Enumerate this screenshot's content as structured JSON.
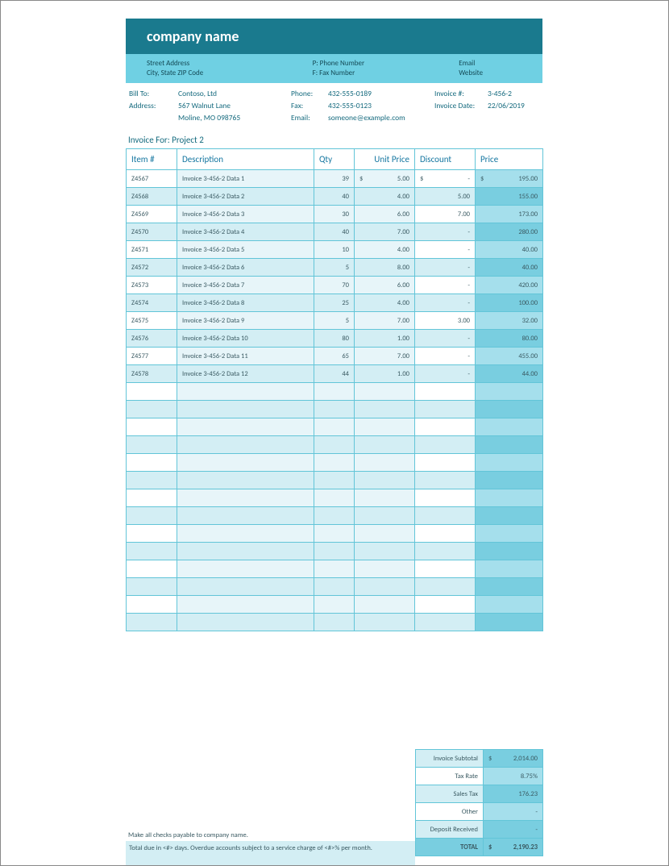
{
  "header": {
    "company": "company name"
  },
  "subheader": {
    "addr1": "Street Address",
    "addr2": "City, State ZIP Code",
    "phone": "P: Phone Number",
    "fax": "F: Fax Number",
    "email": "Email",
    "web": "Website"
  },
  "info": {
    "billto_lbl": "Bill To:",
    "billto": "Contoso, Ltd",
    "address_lbl": "Address:",
    "addr1": "567 Walnut Lane",
    "addr2": "Moline, MO 098765",
    "phone_lbl": "Phone:",
    "phone": "432-555-0189",
    "fax_lbl": "Fax:",
    "fax": "432-555-0123",
    "email_lbl": "Email:",
    "email": "someone@example.com",
    "invnum_lbl": "Invoice #:",
    "invnum": "3-456-2",
    "invdate_lbl": "Invoice Date:",
    "invdate": "22/06/2019"
  },
  "invoice_for_lbl": "Invoice For: ",
  "invoice_for": "Project 2",
  "columns": {
    "item": "Item #",
    "desc": "Description",
    "qty": "Qty",
    "unit": "Unit Price",
    "disc": "Discount",
    "price": "Price"
  },
  "rows": [
    {
      "item": "Z4567",
      "desc": "Invoice 3-456-2 Data 1",
      "qty": "39",
      "unit_cur": "$",
      "unit": "5.00",
      "disc_cur": "$",
      "disc": "-",
      "price_cur": "$",
      "price": "195.00"
    },
    {
      "item": "Z4568",
      "desc": "Invoice 3-456-2 Data 2",
      "qty": "40",
      "unit_cur": "",
      "unit": "4.00",
      "disc_cur": "",
      "disc": "5.00",
      "price_cur": "",
      "price": "155.00"
    },
    {
      "item": "Z4569",
      "desc": "Invoice 3-456-2 Data 3",
      "qty": "30",
      "unit_cur": "",
      "unit": "6.00",
      "disc_cur": "",
      "disc": "7.00",
      "price_cur": "",
      "price": "173.00"
    },
    {
      "item": "Z4570",
      "desc": "Invoice 3-456-2 Data 4",
      "qty": "40",
      "unit_cur": "",
      "unit": "7.00",
      "disc_cur": "",
      "disc": "-",
      "price_cur": "",
      "price": "280.00"
    },
    {
      "item": "Z4571",
      "desc": "Invoice 3-456-2 Data 5",
      "qty": "10",
      "unit_cur": "",
      "unit": "4.00",
      "disc_cur": "",
      "disc": "-",
      "price_cur": "",
      "price": "40.00"
    },
    {
      "item": "Z4572",
      "desc": "Invoice 3-456-2 Data 6",
      "qty": "5",
      "unit_cur": "",
      "unit": "8.00",
      "disc_cur": "",
      "disc": "-",
      "price_cur": "",
      "price": "40.00"
    },
    {
      "item": "Z4573",
      "desc": "Invoice 3-456-2 Data 7",
      "qty": "70",
      "unit_cur": "",
      "unit": "6.00",
      "disc_cur": "",
      "disc": "-",
      "price_cur": "",
      "price": "420.00"
    },
    {
      "item": "Z4574",
      "desc": "Invoice 3-456-2 Data 8",
      "qty": "25",
      "unit_cur": "",
      "unit": "4.00",
      "disc_cur": "",
      "disc": "-",
      "price_cur": "",
      "price": "100.00"
    },
    {
      "item": "Z4575",
      "desc": "Invoice 3-456-2 Data 9",
      "qty": "5",
      "unit_cur": "",
      "unit": "7.00",
      "disc_cur": "",
      "disc": "3.00",
      "price_cur": "",
      "price": "32.00"
    },
    {
      "item": "Z4576",
      "desc": "Invoice 3-456-2 Data 10",
      "qty": "80",
      "unit_cur": "",
      "unit": "1.00",
      "disc_cur": "",
      "disc": "-",
      "price_cur": "",
      "price": "80.00"
    },
    {
      "item": "Z4577",
      "desc": "Invoice 3-456-2 Data 11",
      "qty": "65",
      "unit_cur": "",
      "unit": "7.00",
      "disc_cur": "",
      "disc": "-",
      "price_cur": "",
      "price": "455.00"
    },
    {
      "item": "Z4578",
      "desc": "Invoice 3-456-2 Data 12",
      "qty": "44",
      "unit_cur": "",
      "unit": "1.00",
      "disc_cur": "",
      "disc": "-",
      "price_cur": "",
      "price": "44.00"
    }
  ],
  "blank_rows": 14,
  "summary": [
    {
      "lbl": "Invoice Subtotal",
      "cur": "$",
      "val": "2,014.00",
      "odd": true
    },
    {
      "lbl": "Tax Rate",
      "cur": "",
      "val": "8.75%",
      "odd": false
    },
    {
      "lbl": "Sales Tax",
      "cur": "",
      "val": "176.23",
      "odd": true
    },
    {
      "lbl": "Other",
      "cur": "",
      "val": "-",
      "odd": false
    },
    {
      "lbl": "Deposit Received",
      "cur": "",
      "val": "-",
      "odd": true
    }
  ],
  "total": {
    "lbl": "TOTAL",
    "cur": "$",
    "val": "2,190.23"
  },
  "notes": {
    "n1": "Make all checks payable to company name.",
    "n2": "Total due in <#> days. Overdue accounts subject to a service charge of <#>% per month."
  }
}
